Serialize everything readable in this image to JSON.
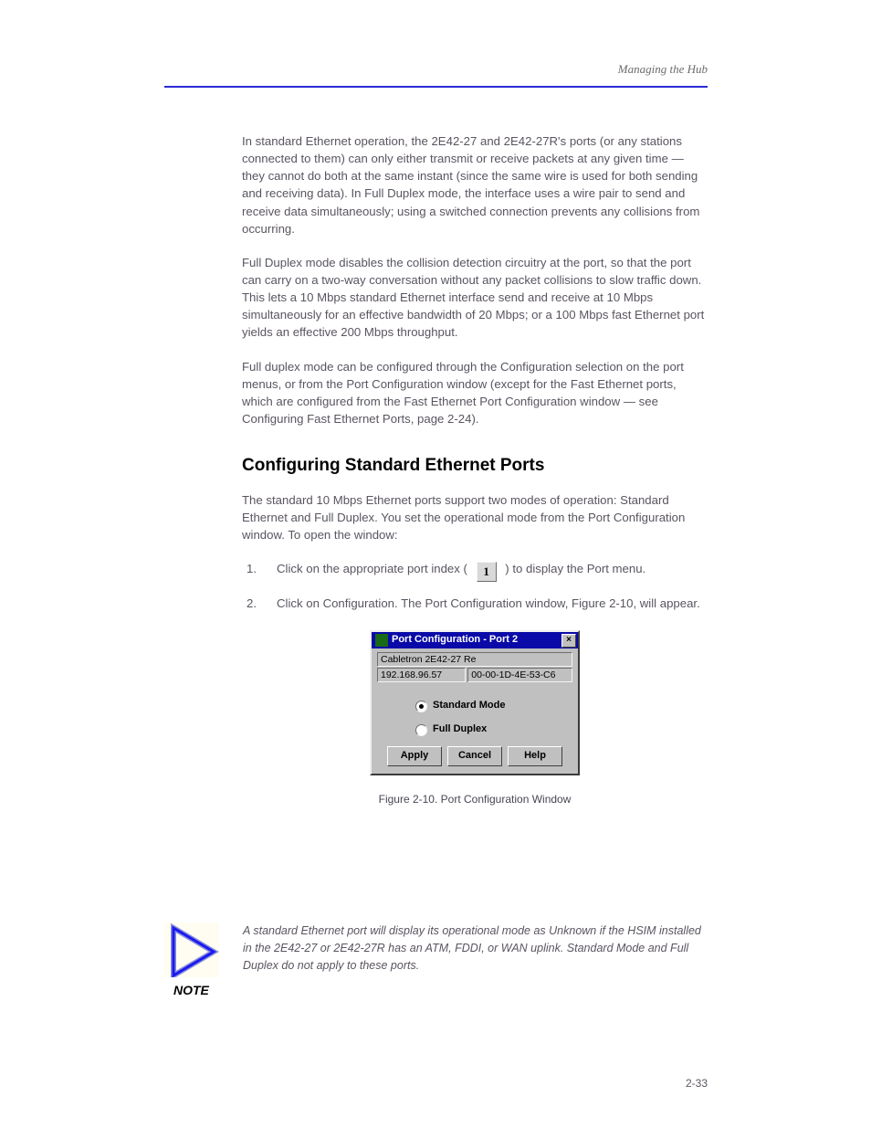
{
  "header": {
    "running_head": "Managing the Hub"
  },
  "intro": {
    "p1": "In standard Ethernet operation, the 2E42-27 and 2E42-27R's ports (or any stations connected to them) can only either transmit or receive packets at any given time — they cannot do both at the same instant (since the same wire is used for both sending and receiving data). In Full Duplex mode, the interface uses a wire pair to send and receive data simultaneously; using a switched connection prevents any collisions from occurring.",
    "p2": "Full Duplex mode disables the collision detection circuitry at the port, so that the port can carry on a two-way conversation without any packet collisions to slow traffic down. This lets a 10 Mbps standard Ethernet interface send and receive at 10 Mbps simultaneously for an effective bandwidth of 20 Mbps; or a 100 Mbps fast Ethernet port yields an effective 200 Mbps throughput.",
    "p3": "Full duplex mode can be configured through the Configuration selection on the port menus, or from the Port Configuration window (except for the Fast Ethernet ports, which are configured from the Fast Ethernet Port Configuration window — see Configuring Fast Ethernet Ports, page 2-24)."
  },
  "section": {
    "title": "Configuring Standard Ethernet Ports",
    "lead": "The standard 10 Mbps Ethernet ports support two modes of operation: Standard Ethernet and Full Duplex. You set the operational mode from the Port Configuration window. To open the window:",
    "step1": "1.",
    "step1_txt_a": "Click on the appropriate port index (",
    "step1_txt_b": ") to display the Port menu.",
    "step_icon": "1",
    "step2": "2.",
    "step2_txt": "Click on Configuration. The Port Configuration window, Figure 2-10, will appear."
  },
  "dialog": {
    "title": "Port Configuration - Port 2",
    "device": "Cabletron 2E42-27 Re",
    "ip": "192.168.96.57",
    "mac": "00-00-1D-4E-53-C6",
    "opt_standard": "Standard Mode",
    "opt_fdx": "Full Duplex",
    "buttons": {
      "apply": "Apply",
      "cancel": "Cancel",
      "help": "Help"
    }
  },
  "figure_caption": "Figure 2-10. Port Configuration Window",
  "note": {
    "label": "NOTE",
    "text": "A standard Ethernet port will display its operational mode as Unknown if the HSIM installed in the 2E42-27 or 2E42-27R has an ATM, FDDI, or WAN uplink. Standard Mode and Full Duplex do not apply to these ports."
  },
  "page_number": "2-33"
}
